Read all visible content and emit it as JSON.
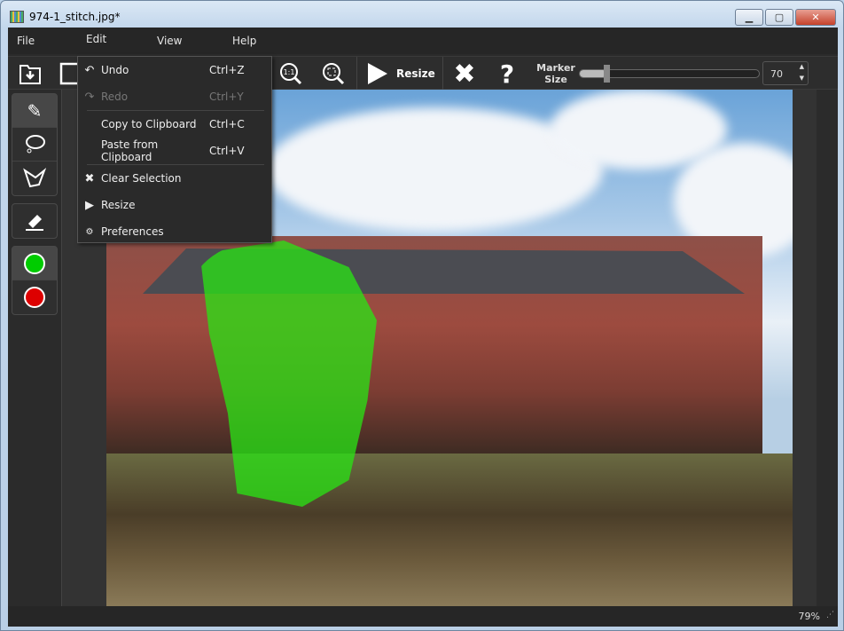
{
  "window": {
    "title": "974-1_stitch.jpg*",
    "minimize": "▁",
    "maximize": "▢",
    "close": "✕"
  },
  "menubar": {
    "items": [
      "File",
      "Edit",
      "View",
      "Help"
    ]
  },
  "toolbar": {
    "resize_label": "Resize",
    "marker_size_label_1": "Marker",
    "marker_size_label_2": "Size",
    "marker_size_value": "70",
    "zoom_actual_label": "1:1"
  },
  "edit_menu": {
    "items": [
      {
        "label": "Undo",
        "shortcut": "Ctrl+Z",
        "icon": "undo-icon",
        "enabled": true
      },
      {
        "label": "Redo",
        "shortcut": "Ctrl+Y",
        "icon": "redo-icon",
        "enabled": false
      },
      {
        "label": "Copy to Clipboard",
        "shortcut": "Ctrl+C",
        "enabled": true
      },
      {
        "label": "Paste from Clipboard",
        "shortcut": "Ctrl+V",
        "enabled": true
      },
      {
        "label": "Clear Selection",
        "icon": "x-icon",
        "enabled": true
      },
      {
        "label": "Resize",
        "icon": "play-icon",
        "enabled": true
      },
      {
        "label": "Preferences",
        "icon": "gears-icon",
        "enabled": true
      }
    ]
  },
  "tools": {
    "selected": "marker",
    "keep_color": "#00cc00",
    "remove_color": "#dd0000"
  },
  "status": {
    "zoom": "79%"
  }
}
